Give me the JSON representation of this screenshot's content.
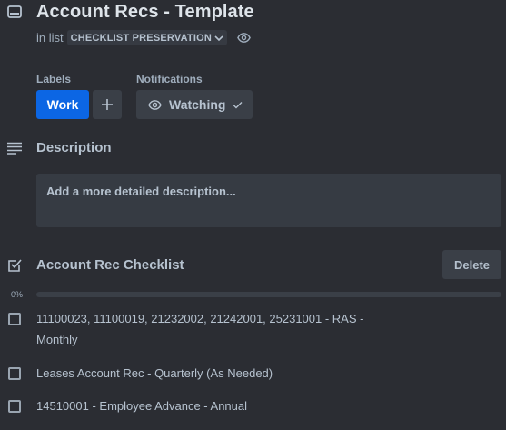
{
  "card": {
    "title": "Account Recs - Template",
    "in_list_prefix": "in list",
    "list_name": "CHECKLIST PRESERVATION"
  },
  "labels": {
    "heading": "Labels",
    "items": [
      {
        "name": "Work",
        "color": "#0c66e4"
      }
    ],
    "add_icon": "plus-icon"
  },
  "notifications": {
    "heading": "Notifications",
    "watch_label": "Watching",
    "watch_icon": "eye-icon",
    "state_icon": "check-icon"
  },
  "description": {
    "heading": "Description",
    "placeholder": "Add a more detailed description..."
  },
  "checklist": {
    "title": "Account Rec Checklist",
    "delete_label": "Delete",
    "progress_label": "0%",
    "progress": 0,
    "items": [
      {
        "text": "11100023, 11100019, 21232002, 21242001, 25231001 - RAS - Monthly",
        "checked": false
      },
      {
        "text": "Leases Account Rec - Quarterly (As Needed)",
        "checked": false
      },
      {
        "text": "14510001 - Employee Advance - Annual",
        "checked": false
      }
    ]
  },
  "colors": {
    "background": "#2b2d33",
    "accent": "#0c66e4",
    "button_bg": "#3a3f47",
    "text": "#b6c2cf"
  }
}
